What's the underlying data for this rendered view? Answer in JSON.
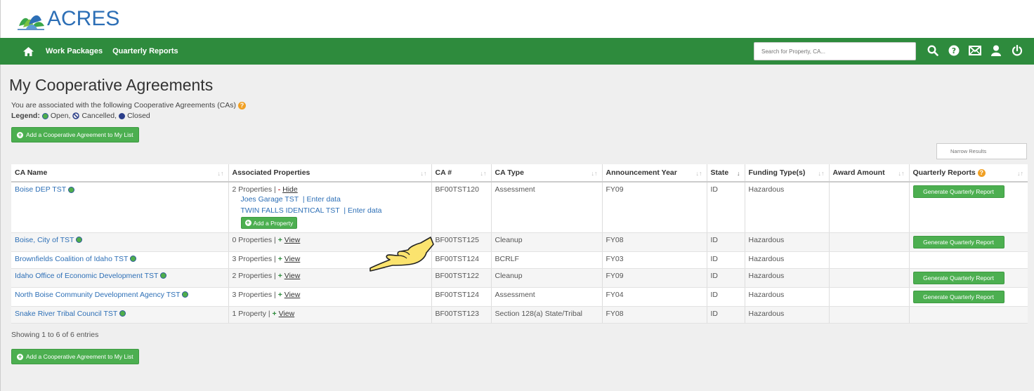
{
  "brand": {
    "name": "ACRES"
  },
  "nav": {
    "links": [
      "Work Packages",
      "Quarterly Reports"
    ],
    "search_placeholder": "Search for Property, CA...",
    "icons": [
      "search-icon",
      "help-icon",
      "mail-icon",
      "user-icon",
      "power-icon"
    ]
  },
  "page": {
    "title": "My Cooperative Agreements",
    "subtitle": "You are associated with the following Cooperative Agreements (CAs)",
    "legend_label": "Legend:",
    "legend_open": "Open,",
    "legend_cancelled": "Cancelled,",
    "legend_closed": "Closed",
    "add_button": "Add a Cooperative Agreement to My List",
    "narrow_placeholder": "Narrow Results",
    "showing": "Showing 1 to 6 of 6 entries"
  },
  "table": {
    "headers": [
      "CA Name",
      "Associated Properties",
      "CA #",
      "CA Type",
      "Announcement Year",
      "State",
      "Funding Type(s)",
      "Award Amount",
      "Quarterly Reports"
    ],
    "generate_label": "Generate Quarterly Report",
    "add_property_label": "Add a Property",
    "hide_label": "Hide",
    "view_label": "View",
    "enter_data_label": "Enter data",
    "rows": [
      {
        "name": "Boise DEP TST",
        "props": "2 Properties |",
        "ca": "BF00TST120",
        "type": "Assessment",
        "year": "FY09",
        "state": "ID",
        "funding": "Hazardous",
        "award": "",
        "sub": [
          "Joes Garage TST",
          "TWIN FALLS IDENTICAL TST"
        ]
      },
      {
        "name": "Boise, City of TST",
        "props": "0 Properties |",
        "ca": "BF00TST125",
        "type": "Cleanup",
        "year": "FY08",
        "state": "ID",
        "funding": "Hazardous",
        "award": ""
      },
      {
        "name": "Brownfields Coalition of Idaho TST",
        "props": "3 Properties |",
        "ca": "BF00TST124",
        "type": "BCRLF",
        "year": "FY03",
        "state": "ID",
        "funding": "Hazardous",
        "award": ""
      },
      {
        "name": "Idaho Office of Economic Development TST",
        "props": "2 Properties |",
        "ca": "BF00TST122",
        "type": "Cleanup",
        "year": "FY09",
        "state": "ID",
        "funding": "Hazardous",
        "award": ""
      },
      {
        "name": "North Boise Community Development Agency TST",
        "props": "3 Properties |",
        "ca": "BF00TST124",
        "type": "Assessment",
        "year": "FY04",
        "state": "ID",
        "funding": "Hazardous",
        "award": ""
      },
      {
        "name": "Snake River Tribal Council TST",
        "props": "1 Property |",
        "ca": "BF00TST123",
        "type": "Section 128(a) State/Tribal",
        "year": "FY08",
        "state": "ID",
        "funding": "Hazardous",
        "award": ""
      }
    ]
  },
  "colors": {
    "nav_green": "#2e8b3d",
    "button_green": "#4caf50",
    "link_blue": "#2d6fb6",
    "help_orange": "#f0a024"
  }
}
